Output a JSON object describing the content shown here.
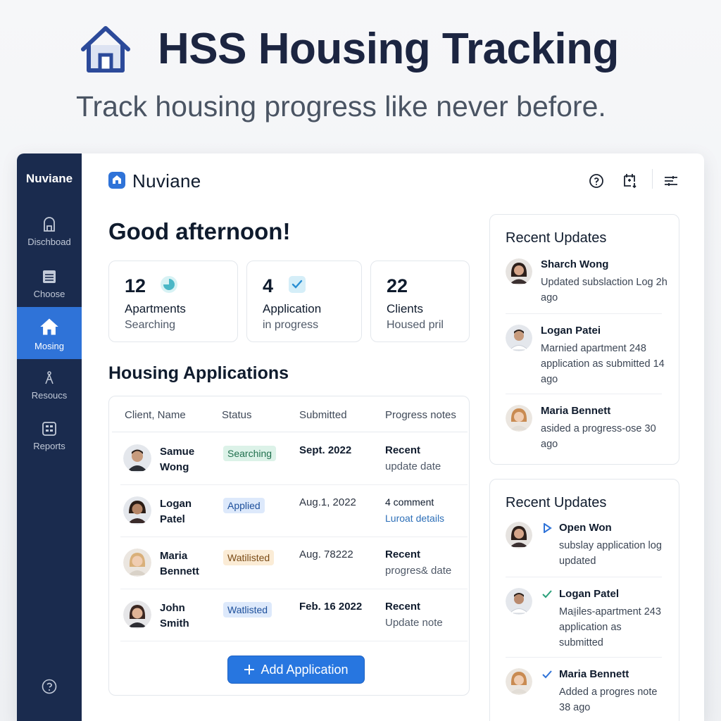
{
  "hero": {
    "title": "HSS Housing Tracking",
    "subtitle": "Track housing progress like never before."
  },
  "sidebar": {
    "brand": "Nuviane",
    "items": [
      {
        "label": "Dischboad",
        "icon": "dashboard-icon",
        "active": false
      },
      {
        "label": "Choose",
        "icon": "document-icon",
        "active": false
      },
      {
        "label": "Mosing",
        "icon": "home-icon",
        "active": true
      },
      {
        "label": "Resoucs",
        "icon": "resources-icon",
        "active": false
      },
      {
        "label": "Reports",
        "icon": "reports-icon",
        "active": false
      }
    ]
  },
  "topbar": {
    "brand": "Nuviane",
    "actions": [
      "help-icon",
      "add-calendar-icon",
      "filter-icon"
    ]
  },
  "greeting": "Good afternoon!",
  "stats": [
    {
      "number": "12",
      "line1": "Apartments",
      "line2": "Searching",
      "icon": "search-status-icon"
    },
    {
      "number": "4",
      "line1": "Application",
      "line2": "in progress",
      "icon": "check-icon"
    },
    {
      "number": "22",
      "line1": "Clients",
      "line2": "Housed pril",
      "icon": ""
    }
  ],
  "applications": {
    "title": "Housing Applications",
    "columns": [
      "Client, Name",
      "Status",
      "Submitted",
      "Progress notes"
    ],
    "rows": [
      {
        "name": "Samue Wong",
        "status": "Searching",
        "submitted": "Sept. 2022",
        "note1": "Recent",
        "note2": "update date"
      },
      {
        "name": "Logan Patel",
        "status": "Applied",
        "submitted": "Aug.1, 2022",
        "note1": "4 comment",
        "note2": "Luroat details"
      },
      {
        "name": "Maria Bennett",
        "status": "Watilisted",
        "submitted": "Aug. 78222",
        "note1": "Recent",
        "note2": "progres& date"
      },
      {
        "name": "John Smith",
        "status": "Watlisted",
        "submitted": "Feb. 16 2022",
        "note1": "Recent",
        "note2": "Update note"
      }
    ],
    "add_button": "Add Application"
  },
  "updates_top": {
    "title": "Recent Updates",
    "items": [
      {
        "name": "Sharch Wong",
        "text": "Updated subslaction Log 2h ago"
      },
      {
        "name": "Logan Patei",
        "text": "Marnied apartment 248 application as submitted 14 ago"
      },
      {
        "name": "Maria Bennett",
        "text": "asided a progress-ose 30 ago"
      }
    ]
  },
  "updates_bottom": {
    "title": "Recent Updates",
    "items": [
      {
        "name": "Open Won",
        "text": "subslay application log updated",
        "marker": "play-icon"
      },
      {
        "name": "Logan Patel",
        "text": "Ma⫲iles-apartment 243 application as submitted",
        "marker": "check-icon"
      },
      {
        "name": "Maria Bennett",
        "text": "Added a progres note 38 ago",
        "marker": "check-icon"
      }
    ]
  },
  "colors": {
    "sidebar_bg": "#1a2b4e",
    "accent": "#2f73d8",
    "button": "#2776e0"
  }
}
